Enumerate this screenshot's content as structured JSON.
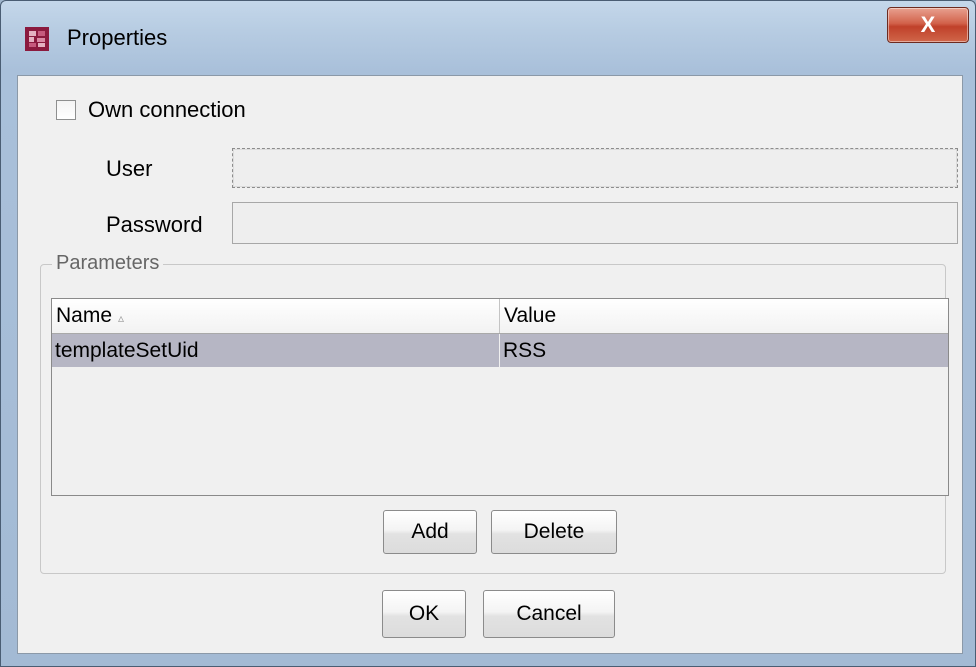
{
  "window": {
    "title": "Properties",
    "close_label": "X"
  },
  "connection": {
    "own_connection_label": "Own connection",
    "own_connection_checked": false,
    "user_label": "User",
    "user_value": "",
    "password_label": "Password",
    "password_value": ""
  },
  "parameters": {
    "legend": "Parameters",
    "columns": [
      "Name",
      "Value"
    ],
    "sort_indicator": "▵",
    "rows": [
      {
        "name": "templateSetUid",
        "value": "RSS"
      }
    ],
    "add_label": "Add",
    "delete_label": "Delete"
  },
  "footer": {
    "ok_label": "OK",
    "cancel_label": "Cancel"
  },
  "colors": {
    "selected_row": "#b6b6c4",
    "client_bg": "#f0f0f0",
    "close_button": "#c0412a",
    "app_icon": "#8b1a3e"
  }
}
